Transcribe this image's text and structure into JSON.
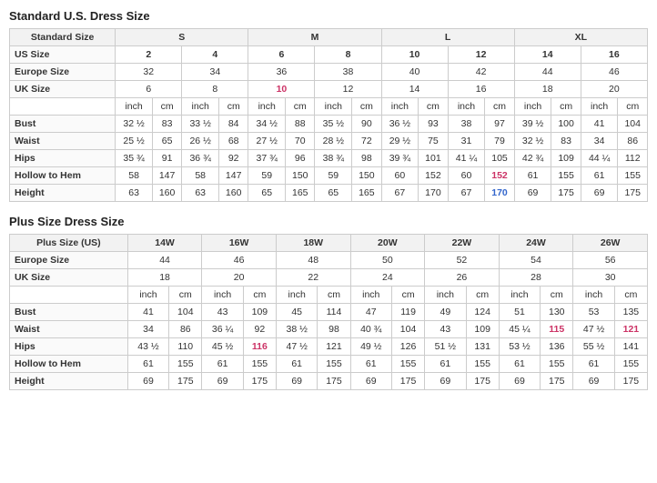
{
  "standard_title": "Standard U.S. Dress Size",
  "plus_title": "Plus Size Dress Size",
  "standard": {
    "size_groups": [
      "S",
      "M",
      "L",
      "XL"
    ],
    "us_sizes": [
      "2",
      "4",
      "6",
      "8",
      "10",
      "12",
      "14",
      "16"
    ],
    "europe_sizes": [
      "32",
      "34",
      "36",
      "38",
      "40",
      "42",
      "44",
      "46"
    ],
    "uk_sizes": [
      "6",
      "8",
      "10",
      "12",
      "14",
      "16",
      "18",
      "20"
    ],
    "rows": [
      {
        "label": "Bust",
        "values": [
          {
            "inch": "32 ½",
            "cm": "83"
          },
          {
            "inch": "33 ½",
            "cm": "84"
          },
          {
            "inch": "34 ½",
            "cm": "88"
          },
          {
            "inch": "35 ½",
            "cm": "90"
          },
          {
            "inch": "36 ½",
            "cm": "93"
          },
          {
            "inch": "38",
            "cm": "97"
          },
          {
            "inch": "39 ½",
            "cm": "100"
          },
          {
            "inch": "41",
            "cm": "104"
          }
        ]
      },
      {
        "label": "Waist",
        "values": [
          {
            "inch": "25 ½",
            "cm": "65"
          },
          {
            "inch": "26 ½",
            "cm": "68"
          },
          {
            "inch": "27 ½",
            "cm": "70"
          },
          {
            "inch": "28 ½",
            "cm": "72"
          },
          {
            "inch": "29 ½",
            "cm": "75"
          },
          {
            "inch": "31",
            "cm": "79"
          },
          {
            "inch": "32 ½",
            "cm": "83"
          },
          {
            "inch": "34",
            "cm": "86"
          }
        ]
      },
      {
        "label": "Hips",
        "values": [
          {
            "inch": "35 ¾",
            "cm": "91"
          },
          {
            "inch": "36 ¾",
            "cm": "92"
          },
          {
            "inch": "37 ¾",
            "cm": "96"
          },
          {
            "inch": "38 ¾",
            "cm": "98"
          },
          {
            "inch": "39 ¾",
            "cm": "101"
          },
          {
            "inch": "41 ¼",
            "cm": "105"
          },
          {
            "inch": "42 ¾",
            "cm": "109"
          },
          {
            "inch": "44 ¼",
            "cm": "112"
          }
        ]
      },
      {
        "label": "Hollow to Hem",
        "values": [
          {
            "inch": "58",
            "cm": "147"
          },
          {
            "inch": "58",
            "cm": "147"
          },
          {
            "inch": "59",
            "cm": "150"
          },
          {
            "inch": "59",
            "cm": "150"
          },
          {
            "inch": "60",
            "cm": "152"
          },
          {
            "inch": "60",
            "cm": "152"
          },
          {
            "inch": "61",
            "cm": "155"
          },
          {
            "inch": "61",
            "cm": "155"
          }
        ]
      },
      {
        "label": "Height",
        "values": [
          {
            "inch": "63",
            "cm": "160"
          },
          {
            "inch": "63",
            "cm": "160"
          },
          {
            "inch": "65",
            "cm": "165"
          },
          {
            "inch": "65",
            "cm": "165"
          },
          {
            "inch": "67",
            "cm": "170"
          },
          {
            "inch": "67",
            "cm": "170"
          },
          {
            "inch": "69",
            "cm": "175"
          },
          {
            "inch": "69",
            "cm": "175"
          }
        ]
      }
    ]
  },
  "plus": {
    "plus_sizes": [
      "14W",
      "16W",
      "18W",
      "20W",
      "22W",
      "24W",
      "26W"
    ],
    "europe_sizes": [
      "44",
      "46",
      "48",
      "50",
      "52",
      "54",
      "56"
    ],
    "uk_sizes": [
      "18",
      "20",
      "22",
      "24",
      "26",
      "28",
      "30"
    ],
    "rows": [
      {
        "label": "Bust",
        "values": [
          {
            "inch": "41",
            "cm": "104"
          },
          {
            "inch": "43",
            "cm": "109"
          },
          {
            "inch": "45",
            "cm": "114"
          },
          {
            "inch": "47",
            "cm": "119"
          },
          {
            "inch": "49",
            "cm": "124"
          },
          {
            "inch": "51",
            "cm": "130"
          },
          {
            "inch": "53",
            "cm": "135"
          }
        ]
      },
      {
        "label": "Waist",
        "values": [
          {
            "inch": "34",
            "cm": "86"
          },
          {
            "inch": "36 ¼",
            "cm": "92"
          },
          {
            "inch": "38 ½",
            "cm": "98"
          },
          {
            "inch": "40 ¾",
            "cm": "104"
          },
          {
            "inch": "43",
            "cm": "109"
          },
          {
            "inch": "45 ¼",
            "cm": "115"
          },
          {
            "inch": "47 ½",
            "cm": "121"
          }
        ]
      },
      {
        "label": "Hips",
        "values": [
          {
            "inch": "43 ½",
            "cm": "110"
          },
          {
            "inch": "45 ½",
            "cm": "116"
          },
          {
            "inch": "47 ½",
            "cm": "121"
          },
          {
            "inch": "49 ½",
            "cm": "126"
          },
          {
            "inch": "51 ½",
            "cm": "131"
          },
          {
            "inch": "53 ½",
            "cm": "136"
          },
          {
            "inch": "55 ½",
            "cm": "141"
          }
        ]
      },
      {
        "label": "Hollow to Hem",
        "values": [
          {
            "inch": "61",
            "cm": "155"
          },
          {
            "inch": "61",
            "cm": "155"
          },
          {
            "inch": "61",
            "cm": "155"
          },
          {
            "inch": "61",
            "cm": "155"
          },
          {
            "inch": "61",
            "cm": "155"
          },
          {
            "inch": "61",
            "cm": "155"
          },
          {
            "inch": "61",
            "cm": "155"
          }
        ]
      },
      {
        "label": "Height",
        "values": [
          {
            "inch": "69",
            "cm": "175"
          },
          {
            "inch": "69",
            "cm": "175"
          },
          {
            "inch": "69",
            "cm": "175"
          },
          {
            "inch": "69",
            "cm": "175"
          },
          {
            "inch": "69",
            "cm": "175"
          },
          {
            "inch": "69",
            "cm": "175"
          },
          {
            "inch": "69",
            "cm": "175"
          }
        ]
      }
    ]
  },
  "highlight_pink_standard": {
    "uk_sizes": [
      2,
      4
    ],
    "waist_15": true,
    "hollow_152": [
      4,
      5
    ],
    "hips_105": true
  }
}
